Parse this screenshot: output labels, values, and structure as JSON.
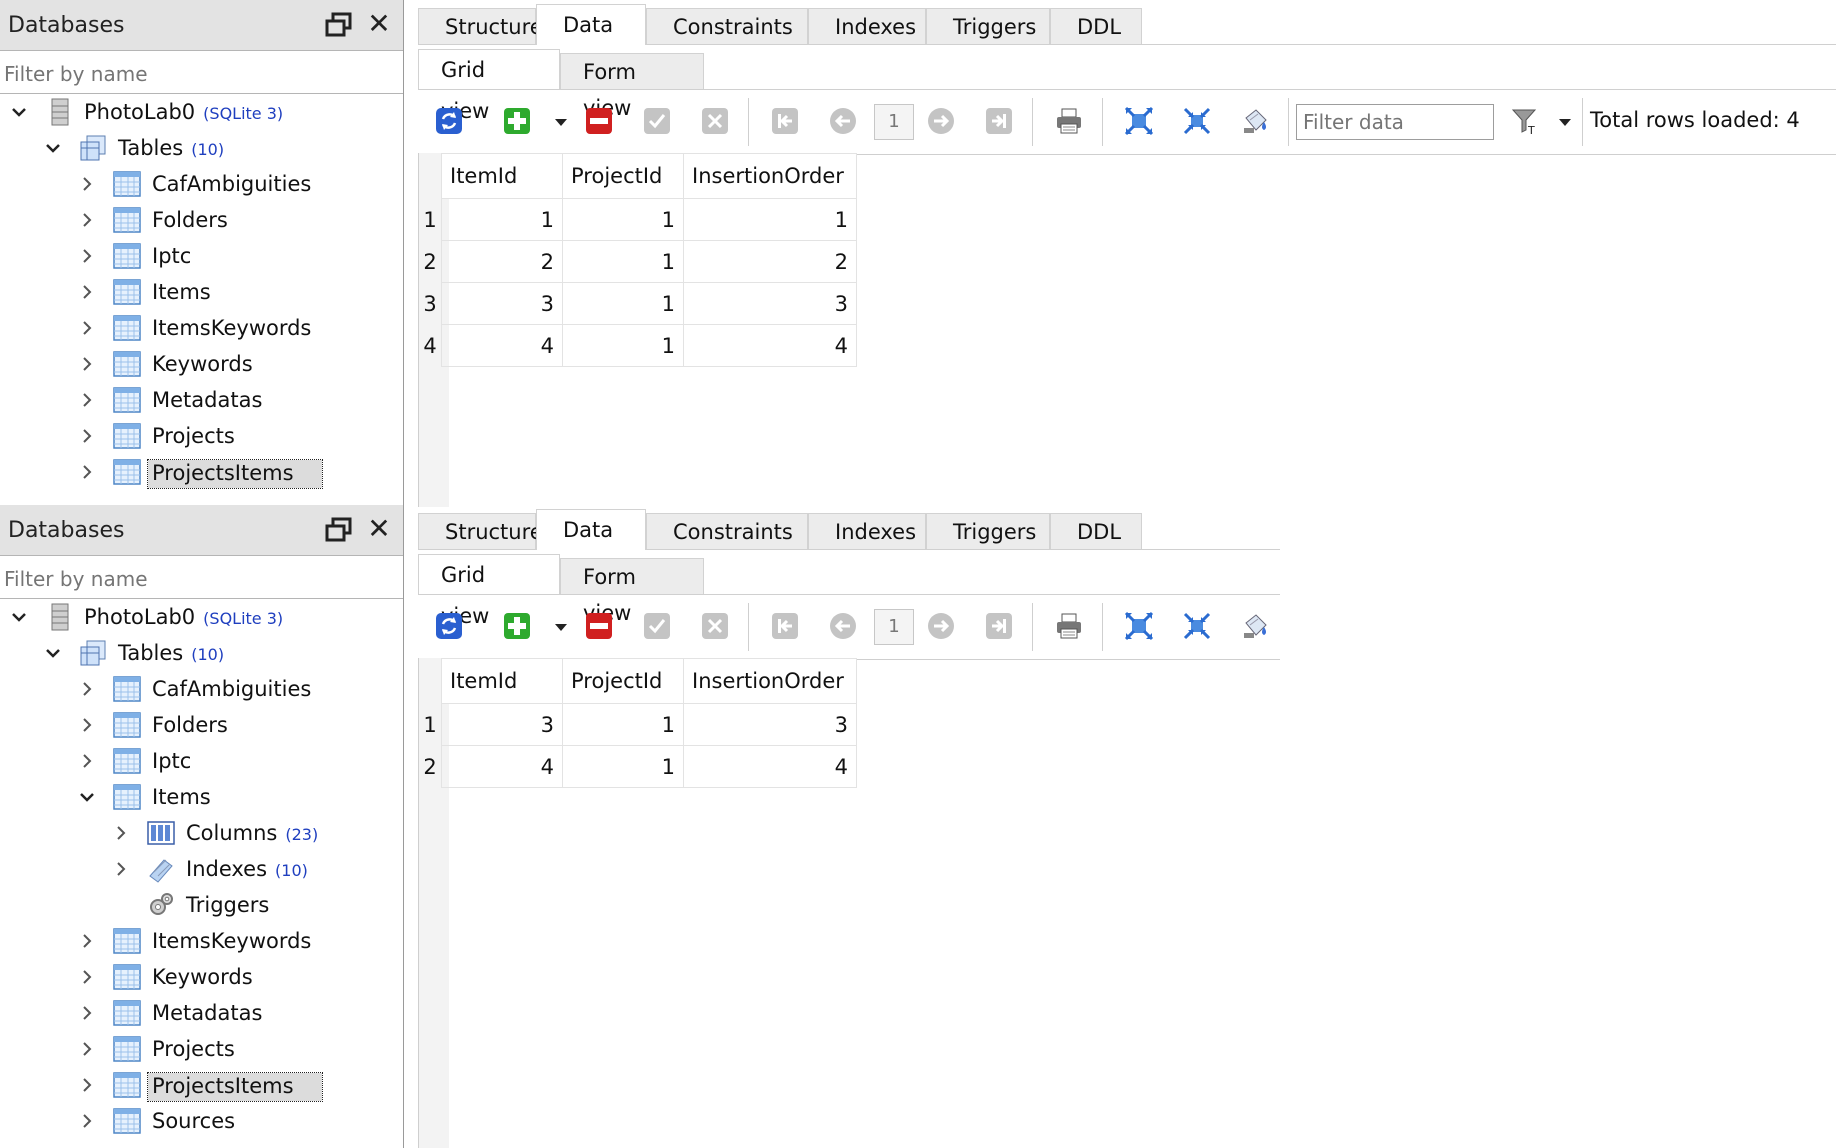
{
  "panes": [
    {
      "sidebar": {
        "title": "Databases",
        "filter_placeholder": "Filter by name",
        "tree": [
          {
            "level": 0,
            "expanded": true,
            "icon": "database-icon",
            "label": "PhotoLab0",
            "count": "(SQLite 3)"
          },
          {
            "level": 1,
            "expanded": true,
            "icon": "tables-icon",
            "label": "Tables",
            "count": "(10)"
          },
          {
            "level": 2,
            "expanded": false,
            "icon": "table-icon",
            "label": "CafAmbiguities"
          },
          {
            "level": 2,
            "expanded": false,
            "icon": "table-icon",
            "label": "Folders"
          },
          {
            "level": 2,
            "expanded": false,
            "icon": "table-icon",
            "label": "Iptc"
          },
          {
            "level": 2,
            "expanded": false,
            "icon": "table-icon",
            "label": "Items"
          },
          {
            "level": 2,
            "expanded": false,
            "icon": "table-icon",
            "label": "ItemsKeywords"
          },
          {
            "level": 2,
            "expanded": false,
            "icon": "table-icon",
            "label": "Keywords"
          },
          {
            "level": 2,
            "expanded": false,
            "icon": "table-icon",
            "label": "Metadatas"
          },
          {
            "level": 2,
            "expanded": false,
            "icon": "table-icon",
            "label": "Projects"
          },
          {
            "level": 2,
            "expanded": false,
            "icon": "table-icon",
            "label": "ProjectsItems",
            "selected": true
          }
        ]
      },
      "tabs": [
        "Structure",
        "Data",
        "Constraints",
        "Indexes",
        "Triggers",
        "DDL"
      ],
      "active_tab": "Data",
      "subtabs": [
        "Grid view",
        "Form view"
      ],
      "active_subtab": "Grid view",
      "page_number": "1",
      "filter_placeholder": "Filter data",
      "status": "Total rows loaded: 4",
      "columns": [
        "ItemId",
        "ProjectId",
        "InsertionOrder"
      ],
      "rows": [
        {
          "n": "1",
          "cells": [
            "1",
            "1",
            "1"
          ]
        },
        {
          "n": "2",
          "cells": [
            "2",
            "1",
            "2"
          ]
        },
        {
          "n": "3",
          "cells": [
            "3",
            "1",
            "3"
          ]
        },
        {
          "n": "4",
          "cells": [
            "4",
            "1",
            "4"
          ]
        }
      ]
    },
    {
      "sidebar": {
        "title": "Databases",
        "filter_placeholder": "Filter by name",
        "tree": [
          {
            "level": 0,
            "expanded": true,
            "icon": "database-icon",
            "label": "PhotoLab0",
            "count": "(SQLite 3)"
          },
          {
            "level": 1,
            "expanded": true,
            "icon": "tables-icon",
            "label": "Tables",
            "count": "(10)"
          },
          {
            "level": 2,
            "expanded": false,
            "icon": "table-icon",
            "label": "CafAmbiguities"
          },
          {
            "level": 2,
            "expanded": false,
            "icon": "table-icon",
            "label": "Folders"
          },
          {
            "level": 2,
            "expanded": false,
            "icon": "table-icon",
            "label": "Iptc"
          },
          {
            "level": 2,
            "expanded": true,
            "icon": "table-icon",
            "label": "Items"
          },
          {
            "level": 3,
            "expanded": false,
            "icon": "columns-icon",
            "label": "Columns",
            "count": "(23)"
          },
          {
            "level": 3,
            "expanded": false,
            "icon": "indexes-icon",
            "label": "Indexes",
            "count": "(10)"
          },
          {
            "level": 3,
            "leaf": true,
            "icon": "triggers-icon",
            "label": "Triggers"
          },
          {
            "level": 2,
            "expanded": false,
            "icon": "table-icon",
            "label": "ItemsKeywords"
          },
          {
            "level": 2,
            "expanded": false,
            "icon": "table-icon",
            "label": "Keywords"
          },
          {
            "level": 2,
            "expanded": false,
            "icon": "table-icon",
            "label": "Metadatas"
          },
          {
            "level": 2,
            "expanded": false,
            "icon": "table-icon",
            "label": "Projects"
          },
          {
            "level": 2,
            "expanded": false,
            "icon": "table-icon",
            "label": "ProjectsItems",
            "selected": true
          },
          {
            "level": 2,
            "expanded": false,
            "icon": "table-icon",
            "label": "Sources"
          }
        ]
      },
      "tabs": [
        "Structure",
        "Data",
        "Constraints",
        "Indexes",
        "Triggers",
        "DDL"
      ],
      "active_tab": "Data",
      "subtabs": [
        "Grid view",
        "Form view"
      ],
      "active_subtab": "Grid view",
      "page_number": "1",
      "columns": [
        "ItemId",
        "ProjectId",
        "InsertionOrder"
      ],
      "rows": [
        {
          "n": "1",
          "cells": [
            "3",
            "1",
            "3"
          ]
        },
        {
          "n": "2",
          "cells": [
            "4",
            "1",
            "4"
          ]
        }
      ]
    }
  ],
  "colors": {
    "link_count": "#1f3fbf",
    "tab_bg": "#ececec",
    "header_bg": "#e3e3e3",
    "add_green": "#2eaa2e",
    "delete_red": "#d02020",
    "refresh_blue": "#2a5fd0"
  }
}
